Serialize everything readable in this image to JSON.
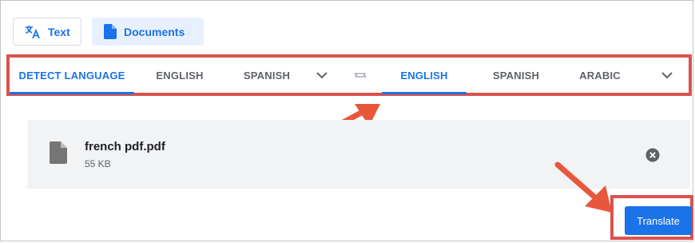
{
  "modes": {
    "text_label": "Text",
    "documents_label": "Documents",
    "text_icon": "translate-icon",
    "documents_icon": "document-icon"
  },
  "source_languages": {
    "tabs": [
      "DETECT LANGUAGE",
      "ENGLISH",
      "SPANISH"
    ],
    "active_index": 0,
    "more_icon": "chevron-down-icon"
  },
  "swap_icon": "swap-languages-icon",
  "target_languages": {
    "tabs": [
      "ENGLISH",
      "SPANISH",
      "ARABIC"
    ],
    "active_index": 0,
    "more_icon": "chevron-down-icon"
  },
  "file": {
    "name": "french pdf.pdf",
    "size": "55 KB",
    "icon": "document-icon",
    "remove_icon": "close-circle-icon"
  },
  "translate_button": {
    "label": "Translate"
  },
  "colors": {
    "accent": "#1a73e8",
    "highlight_box": "#d9534f",
    "annotation_arrow": "#e8573c"
  }
}
